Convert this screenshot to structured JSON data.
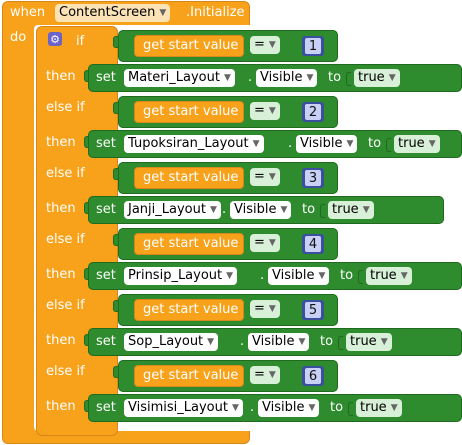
{
  "event": {
    "when": "when",
    "component": "ContentScreen",
    "event_name": ".Initialize",
    "do": "do"
  },
  "gear_icon": "gear-icon",
  "branches": [
    {
      "keyword": "if",
      "then": "then",
      "get_label": "get start value",
      "op": "=",
      "num": "1",
      "layout": "Materi_Layout",
      "prop": "Visible",
      "value": "true"
    },
    {
      "keyword": "else if",
      "then": "then",
      "get_label": "get start value",
      "op": "=",
      "num": "2",
      "layout": "Tupoksiran_Layout",
      "prop": "Visible",
      "value": "true"
    },
    {
      "keyword": "else if",
      "then": "then",
      "get_label": "get start value",
      "op": "=",
      "num": "3",
      "layout": "Janji_Layout",
      "prop": "Visible",
      "value": "true"
    },
    {
      "keyword": "else if",
      "then": "then",
      "get_label": "get start value",
      "op": "=",
      "num": "4",
      "layout": "Prinsip_Layout",
      "prop": "Visible",
      "value": "true"
    },
    {
      "keyword": "else if",
      "then": "then",
      "get_label": "get start value",
      "op": "=",
      "num": "5",
      "layout": "Sop_Layout",
      "prop": "Visible",
      "value": "true"
    },
    {
      "keyword": "else if",
      "then": "then",
      "get_label": "get start value",
      "op": "=",
      "num": "6",
      "layout": "Visimisi_Layout",
      "prop": "Visible",
      "value": "true"
    }
  ],
  "set_word": "set",
  "to_word": "to",
  "dot": "."
}
